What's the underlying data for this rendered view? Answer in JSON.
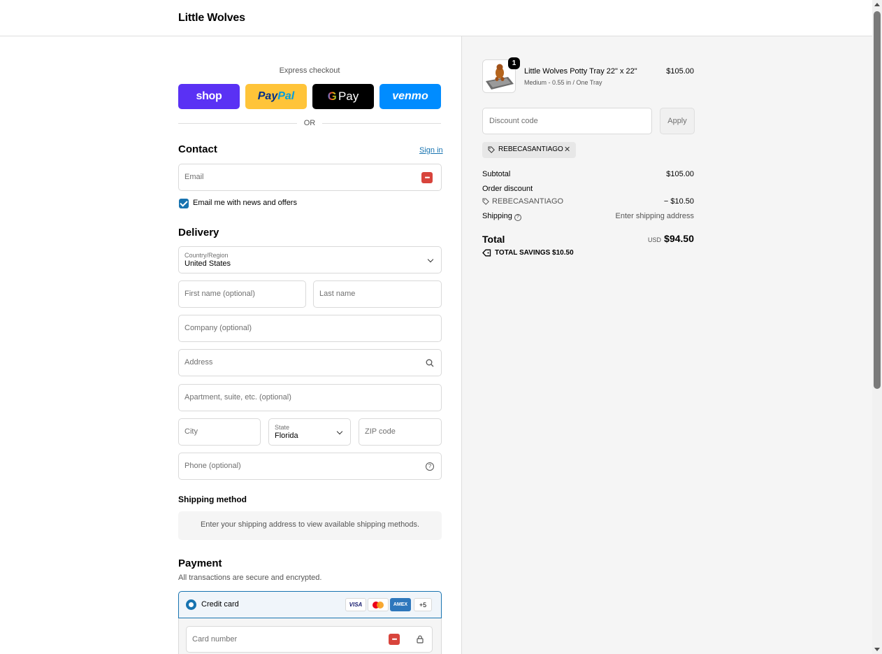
{
  "header": {
    "brand": "Little Wolves"
  },
  "express": {
    "label": "Express checkout",
    "shop": "shop",
    "paypal_a": "Pay",
    "paypal_b": "Pal",
    "gpay_g": "G",
    "gpay_pay": "Pay",
    "venmo": "venmo",
    "or": "OR"
  },
  "contact": {
    "title": "Contact",
    "signin": "Sign in",
    "email_placeholder": "Email",
    "newsletter_label": "Email me with news and offers",
    "newsletter_checked": true
  },
  "delivery": {
    "title": "Delivery",
    "country_label": "Country/Region",
    "country_value": "United States",
    "first_name": "First name (optional)",
    "last_name": "Last name",
    "company": "Company (optional)",
    "address": "Address",
    "apartment": "Apartment, suite, etc. (optional)",
    "city": "City",
    "state_label": "State",
    "state_value": "Florida",
    "zip": "ZIP code",
    "phone": "Phone (optional)"
  },
  "shipping": {
    "title": "Shipping method",
    "message": "Enter your shipping address to view available shipping methods."
  },
  "payment": {
    "title": "Payment",
    "subtitle": "All transactions are secure and encrypted.",
    "method_label": "Credit card",
    "badges": {
      "visa": "VISA",
      "amex": "AMEX",
      "more": "+5"
    },
    "card_number": "Card number"
  },
  "summary": {
    "item": {
      "quantity": "1",
      "name": "Little Wolves Potty Tray 22\" x 22\"",
      "variant": "Medium - 0.55 in / One Tray",
      "price": "$105.00"
    },
    "discount_placeholder": "Discount code",
    "apply": "Apply",
    "applied_code": "REBECASANTIAGO",
    "subtotal_label": "Subtotal",
    "subtotal_value": "$105.00",
    "order_discount_label": "Order discount",
    "order_discount_code": "REBECASANTIAGO",
    "order_discount_value": "− $10.50",
    "shipping_label": "Shipping",
    "shipping_value": "Enter shipping address",
    "total_label": "Total",
    "currency": "USD",
    "total_value": "$94.50",
    "savings": "TOTAL SAVINGS  $10.50"
  },
  "colors": {
    "accent": "#1773b0",
    "shop": "#5a31f4",
    "paypal": "#ffc439",
    "gpay": "#000000",
    "venmo": "#008cff",
    "summary_bg": "#f5f5f5"
  }
}
